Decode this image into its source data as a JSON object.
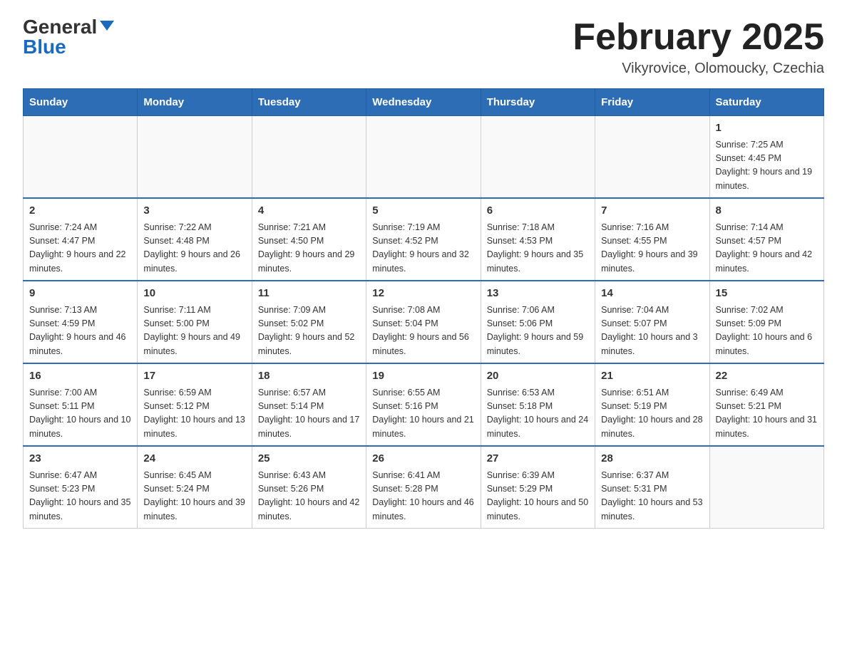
{
  "header": {
    "logo_general": "General",
    "logo_blue": "Blue",
    "calendar_title": "February 2025",
    "calendar_subtitle": "Vikyrovice, Olomoucky, Czechia"
  },
  "weekdays": [
    "Sunday",
    "Monday",
    "Tuesday",
    "Wednesday",
    "Thursday",
    "Friday",
    "Saturday"
  ],
  "weeks": [
    [
      {
        "day": "",
        "info": []
      },
      {
        "day": "",
        "info": []
      },
      {
        "day": "",
        "info": []
      },
      {
        "day": "",
        "info": []
      },
      {
        "day": "",
        "info": []
      },
      {
        "day": "",
        "info": []
      },
      {
        "day": "1",
        "info": [
          "Sunrise: 7:25 AM",
          "Sunset: 4:45 PM",
          "Daylight: 9 hours and 19 minutes."
        ]
      }
    ],
    [
      {
        "day": "2",
        "info": [
          "Sunrise: 7:24 AM",
          "Sunset: 4:47 PM",
          "Daylight: 9 hours and 22 minutes."
        ]
      },
      {
        "day": "3",
        "info": [
          "Sunrise: 7:22 AM",
          "Sunset: 4:48 PM",
          "Daylight: 9 hours and 26 minutes."
        ]
      },
      {
        "day": "4",
        "info": [
          "Sunrise: 7:21 AM",
          "Sunset: 4:50 PM",
          "Daylight: 9 hours and 29 minutes."
        ]
      },
      {
        "day": "5",
        "info": [
          "Sunrise: 7:19 AM",
          "Sunset: 4:52 PM",
          "Daylight: 9 hours and 32 minutes."
        ]
      },
      {
        "day": "6",
        "info": [
          "Sunrise: 7:18 AM",
          "Sunset: 4:53 PM",
          "Daylight: 9 hours and 35 minutes."
        ]
      },
      {
        "day": "7",
        "info": [
          "Sunrise: 7:16 AM",
          "Sunset: 4:55 PM",
          "Daylight: 9 hours and 39 minutes."
        ]
      },
      {
        "day": "8",
        "info": [
          "Sunrise: 7:14 AM",
          "Sunset: 4:57 PM",
          "Daylight: 9 hours and 42 minutes."
        ]
      }
    ],
    [
      {
        "day": "9",
        "info": [
          "Sunrise: 7:13 AM",
          "Sunset: 4:59 PM",
          "Daylight: 9 hours and 46 minutes."
        ]
      },
      {
        "day": "10",
        "info": [
          "Sunrise: 7:11 AM",
          "Sunset: 5:00 PM",
          "Daylight: 9 hours and 49 minutes."
        ]
      },
      {
        "day": "11",
        "info": [
          "Sunrise: 7:09 AM",
          "Sunset: 5:02 PM",
          "Daylight: 9 hours and 52 minutes."
        ]
      },
      {
        "day": "12",
        "info": [
          "Sunrise: 7:08 AM",
          "Sunset: 5:04 PM",
          "Daylight: 9 hours and 56 minutes."
        ]
      },
      {
        "day": "13",
        "info": [
          "Sunrise: 7:06 AM",
          "Sunset: 5:06 PM",
          "Daylight: 9 hours and 59 minutes."
        ]
      },
      {
        "day": "14",
        "info": [
          "Sunrise: 7:04 AM",
          "Sunset: 5:07 PM",
          "Daylight: 10 hours and 3 minutes."
        ]
      },
      {
        "day": "15",
        "info": [
          "Sunrise: 7:02 AM",
          "Sunset: 5:09 PM",
          "Daylight: 10 hours and 6 minutes."
        ]
      }
    ],
    [
      {
        "day": "16",
        "info": [
          "Sunrise: 7:00 AM",
          "Sunset: 5:11 PM",
          "Daylight: 10 hours and 10 minutes."
        ]
      },
      {
        "day": "17",
        "info": [
          "Sunrise: 6:59 AM",
          "Sunset: 5:12 PM",
          "Daylight: 10 hours and 13 minutes."
        ]
      },
      {
        "day": "18",
        "info": [
          "Sunrise: 6:57 AM",
          "Sunset: 5:14 PM",
          "Daylight: 10 hours and 17 minutes."
        ]
      },
      {
        "day": "19",
        "info": [
          "Sunrise: 6:55 AM",
          "Sunset: 5:16 PM",
          "Daylight: 10 hours and 21 minutes."
        ]
      },
      {
        "day": "20",
        "info": [
          "Sunrise: 6:53 AM",
          "Sunset: 5:18 PM",
          "Daylight: 10 hours and 24 minutes."
        ]
      },
      {
        "day": "21",
        "info": [
          "Sunrise: 6:51 AM",
          "Sunset: 5:19 PM",
          "Daylight: 10 hours and 28 minutes."
        ]
      },
      {
        "day": "22",
        "info": [
          "Sunrise: 6:49 AM",
          "Sunset: 5:21 PM",
          "Daylight: 10 hours and 31 minutes."
        ]
      }
    ],
    [
      {
        "day": "23",
        "info": [
          "Sunrise: 6:47 AM",
          "Sunset: 5:23 PM",
          "Daylight: 10 hours and 35 minutes."
        ]
      },
      {
        "day": "24",
        "info": [
          "Sunrise: 6:45 AM",
          "Sunset: 5:24 PM",
          "Daylight: 10 hours and 39 minutes."
        ]
      },
      {
        "day": "25",
        "info": [
          "Sunrise: 6:43 AM",
          "Sunset: 5:26 PM",
          "Daylight: 10 hours and 42 minutes."
        ]
      },
      {
        "day": "26",
        "info": [
          "Sunrise: 6:41 AM",
          "Sunset: 5:28 PM",
          "Daylight: 10 hours and 46 minutes."
        ]
      },
      {
        "day": "27",
        "info": [
          "Sunrise: 6:39 AM",
          "Sunset: 5:29 PM",
          "Daylight: 10 hours and 50 minutes."
        ]
      },
      {
        "day": "28",
        "info": [
          "Sunrise: 6:37 AM",
          "Sunset: 5:31 PM",
          "Daylight: 10 hours and 53 minutes."
        ]
      },
      {
        "day": "",
        "info": []
      }
    ]
  ]
}
